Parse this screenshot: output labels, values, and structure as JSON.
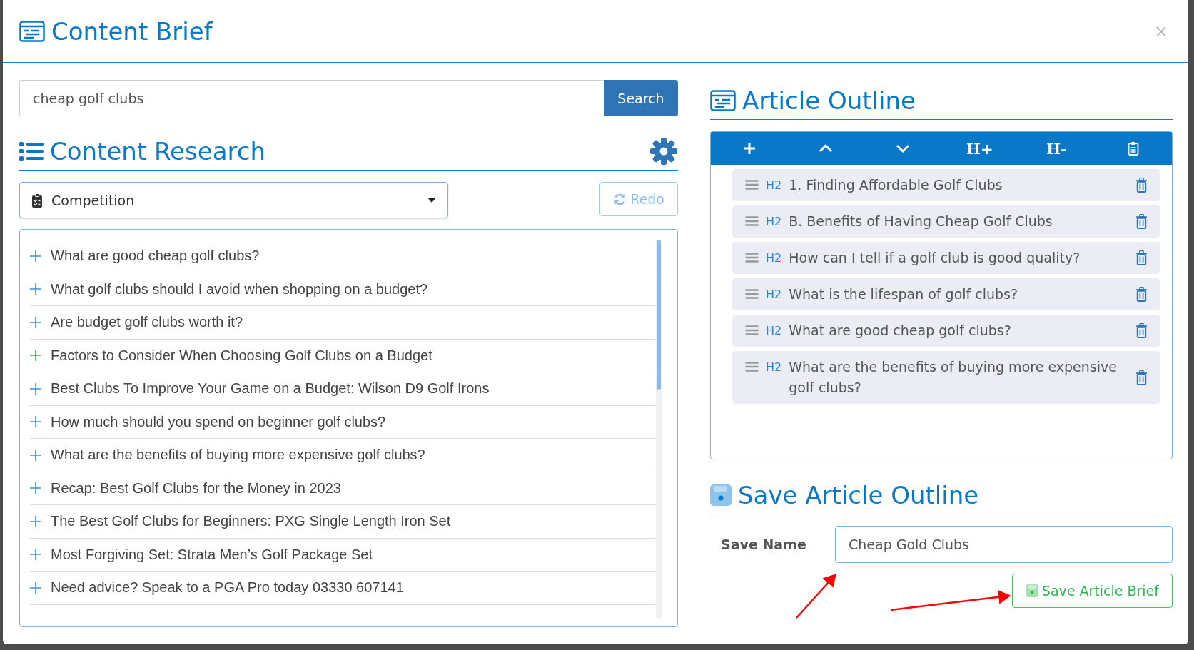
{
  "modal": {
    "title": "Content Brief",
    "close": "×"
  },
  "search": {
    "value": "cheap golf clubs",
    "button": "Search"
  },
  "research": {
    "title": "Content Research",
    "dropdown": "Competition",
    "redo": "Redo",
    "items": [
      "What are good cheap golf clubs?",
      "What golf clubs should I avoid when shopping on a budget?",
      "Are budget golf clubs worth it?",
      "Factors to Consider When Choosing Golf Clubs on a Budget",
      "Best Clubs To Improve Your Game on a Budget: Wilson D9 Golf Irons",
      "How much should you spend on beginner golf clubs?",
      "What are the benefits of buying more expensive golf clubs?",
      "Recap: Best Golf Clubs for the Money in 2023",
      "The Best Golf Clubs for Beginners: PXG Single Length Iron Set",
      "Most Forgiving Set: Strata Men’s Golf Package Set",
      "Need advice? Speak to a PGA Pro today 03330 607141"
    ]
  },
  "outline": {
    "title": "Article Outline",
    "toolbar": [
      {
        "kind": "add"
      },
      {
        "kind": "up"
      },
      {
        "kind": "down"
      },
      {
        "kind": "text",
        "label": "H+"
      },
      {
        "kind": "text",
        "label": "H-"
      },
      {
        "kind": "clipboard"
      }
    ],
    "items": [
      {
        "level": "H2",
        "text": "1. Finding Affordable Golf Clubs"
      },
      {
        "level": "H2",
        "text": "B. Benefits of Having Cheap Golf Clubs"
      },
      {
        "level": "H2",
        "text": "How can I tell if a golf club is good quality?"
      },
      {
        "level": "H2",
        "text": "What is the lifespan of golf clubs?"
      },
      {
        "level": "H2",
        "text": "What are good cheap golf clubs?"
      },
      {
        "level": "H2",
        "text": "What are the benefits of buying more expensive golf clubs?"
      }
    ]
  },
  "save": {
    "title": "Save Article Outline",
    "label": "Save Name",
    "value": "Cheap Gold Clubs",
    "button": "Save Article Brief"
  }
}
